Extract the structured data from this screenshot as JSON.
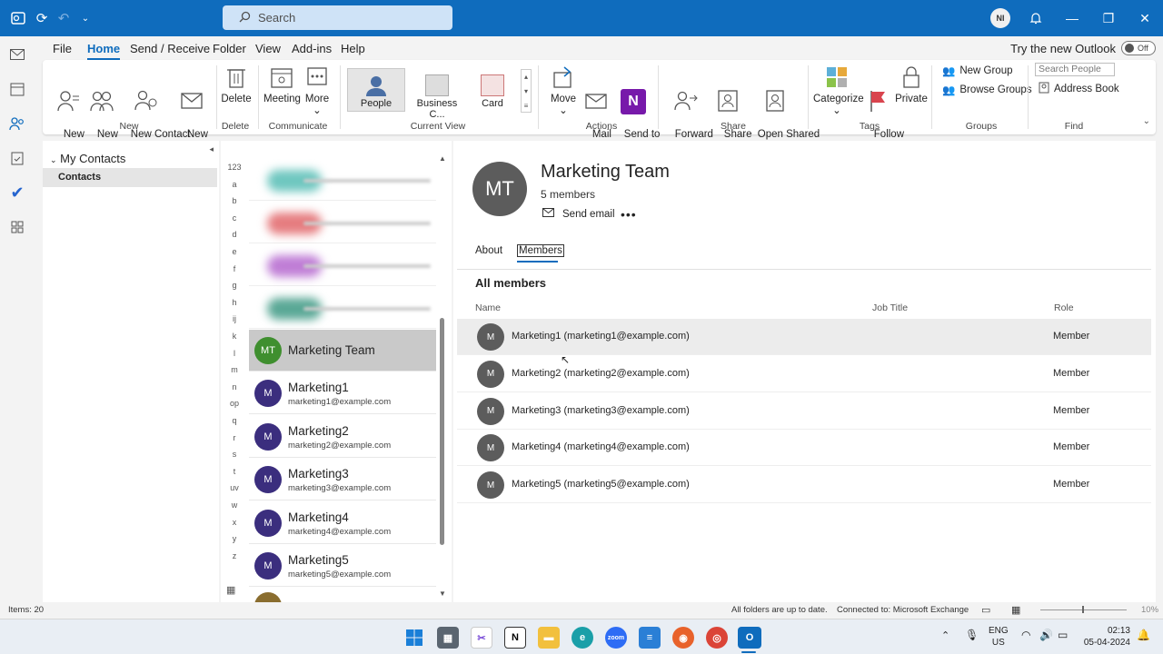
{
  "app": {
    "search_placeholder": "Search"
  },
  "user": {
    "initials": "NI"
  },
  "menu": {
    "items": [
      "File",
      "Home",
      "Send / Receive",
      "Folder",
      "View",
      "Add-ins",
      "Help"
    ],
    "active": "Home",
    "try_new": "Try the new Outlook",
    "toggle": "Off"
  },
  "ribbon": {
    "new_contact": "New\nContact",
    "new_group": "New\nGroup",
    "new_contact_group": "New Contact\nGroup",
    "new_items": "New\nItems",
    "group_new": "New",
    "delete": "Delete",
    "group_delete": "Delete",
    "meeting": "Meeting",
    "more": "More",
    "group_communicate": "Communicate",
    "view_people": "People",
    "view_business": "Business C...",
    "view_card": "Card",
    "group_current_view": "Current View",
    "move": "Move",
    "mail_merge": "Mail\nMerge",
    "send_onenote": "Send to\nOneNote",
    "group_actions": "Actions",
    "forward_contact": "Forward\nContact",
    "share_contacts": "Share\nContacts",
    "open_shared": "Open Shared\nContacts",
    "group_share": "Share",
    "categorize": "Categorize",
    "follow_up": "Follow\nUp",
    "private": "Private",
    "group_tags": "Tags",
    "new_group_btn": "New Group",
    "browse_groups": "Browse Groups",
    "group_groups": "Groups",
    "search_people": "Search People",
    "address_book": "Address Book",
    "group_find": "Find"
  },
  "folders": {
    "header": "My Contacts",
    "selected": "Contacts"
  },
  "alphabet": [
    "123",
    "a",
    "b",
    "c",
    "d",
    "e",
    "f",
    "g",
    "h",
    "ij",
    "k",
    "l",
    "m",
    "n",
    "op",
    "q",
    "r",
    "s",
    "t",
    "uv",
    "w",
    "x",
    "y",
    "z"
  ],
  "contacts": [
    {
      "initials": "MT",
      "name": "Marketing Team",
      "email": "",
      "selected": true,
      "color": "#3f8f2f"
    },
    {
      "initials": "M",
      "name": "Marketing1",
      "email": "marketing1@example.com",
      "color": "#3b2e7e"
    },
    {
      "initials": "M",
      "name": "Marketing2",
      "email": "marketing2@example.com",
      "color": "#3b2e7e"
    },
    {
      "initials": "M",
      "name": "Marketing3",
      "email": "marketing3@example.com",
      "color": "#3b2e7e"
    },
    {
      "initials": "M",
      "name": "Marketing4",
      "email": "marketing4@example.com",
      "color": "#3b2e7e"
    },
    {
      "initials": "M",
      "name": "Marketing5",
      "email": "marketing5@example.com",
      "color": "#3b2e7e"
    }
  ],
  "detail": {
    "initials": "MT",
    "name": "Marketing Team",
    "member_count": "5 members",
    "send_email": "Send email",
    "tab_about": "About",
    "tab_members": "Members",
    "section_title": "All members",
    "col_name": "Name",
    "col_job": "Job Title",
    "col_role": "Role",
    "members": [
      {
        "initials": "M",
        "label": "Marketing1 (marketing1@example.com)",
        "role": "Member"
      },
      {
        "initials": "M",
        "label": "Marketing2 (marketing2@example.com)",
        "role": "Member"
      },
      {
        "initials": "M",
        "label": "Marketing3 (marketing3@example.com)",
        "role": "Member"
      },
      {
        "initials": "M",
        "label": "Marketing4 (marketing4@example.com)",
        "role": "Member"
      },
      {
        "initials": "M",
        "label": "Marketing5 (marketing5@example.com)",
        "role": "Member"
      }
    ]
  },
  "status": {
    "items": "Items: 20",
    "sync": "All folders are up to date.",
    "connection": "Connected to: Microsoft Exchange",
    "zoom": "10%"
  },
  "taskbar": {
    "lang1": "ENG",
    "lang2": "US",
    "time": "02:13",
    "date": "05-04-2024"
  }
}
